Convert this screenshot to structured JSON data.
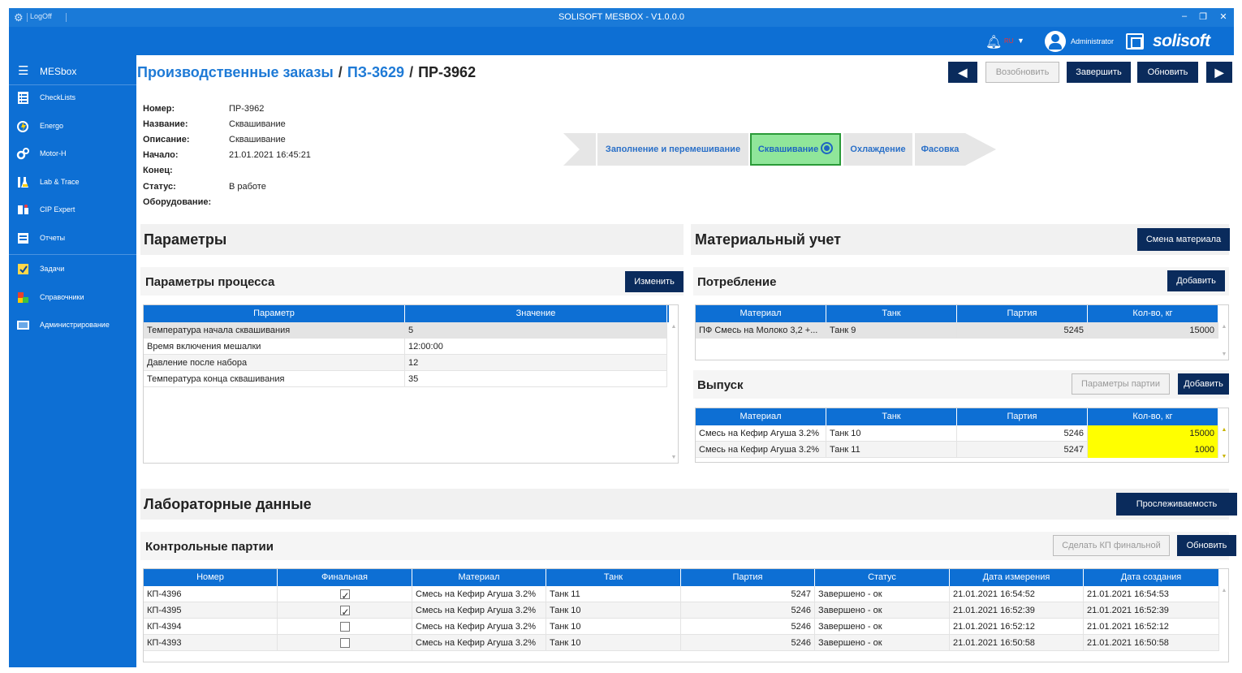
{
  "window": {
    "logoff": "LogOff",
    "title": "SOLISOFT MESBOX - V1.0.0.0",
    "minimize": "–",
    "restore": "❐",
    "close": "✕"
  },
  "topbar": {
    "lang": "RU",
    "user": "Administrator",
    "brand": "solisoft"
  },
  "sidebar": {
    "title": "MESbox",
    "items": [
      {
        "label": "CheckLists",
        "icon": "checklist-icon",
        "color": "#ffffff"
      },
      {
        "label": "Energo",
        "icon": "energy-icon",
        "color": "#ffcc00"
      },
      {
        "label": "Motor-H",
        "icon": "gears-icon",
        "color": "#ffffff"
      },
      {
        "label": "Lab & Trace",
        "icon": "lab-flask-icon",
        "color": "#ffffff"
      },
      {
        "label": "CIP Expert",
        "icon": "cip-icon",
        "color": "#ffffff"
      },
      {
        "label": "Отчеты",
        "icon": "report-icon",
        "color": "#ffffff"
      },
      {
        "label": "Задачи",
        "icon": "tasks-icon",
        "color": "#ffd84a"
      },
      {
        "label": "Справочники",
        "icon": "directory-icon",
        "color": "#e8402a"
      },
      {
        "label": "Администрирование",
        "icon": "admin-icon",
        "color": "#ffffff"
      }
    ]
  },
  "breadcrumb": {
    "root": "Производственные заказы",
    "sep": "/",
    "parent": "ПЗ-3629",
    "current": "ПР-3962"
  },
  "toolbar": {
    "back_icon": "◀",
    "resume": "Возобновить",
    "finish": "Завершить",
    "refresh": "Обновить",
    "forward_icon": "▶"
  },
  "info": {
    "number": {
      "label": "Номер:",
      "value": "ПР-3962"
    },
    "name": {
      "label": "Название:",
      "value": "Сквашивание"
    },
    "description": {
      "label": "Описание:",
      "value": "Сквашивание"
    },
    "start": {
      "label": "Начало:",
      "value": "21.01.2021 16:45:21"
    },
    "end": {
      "label": "Конец:",
      "value": ""
    },
    "status": {
      "label": "Статус:",
      "value": "В работе"
    },
    "equipment": {
      "label": "Оборудование:",
      "value": ""
    }
  },
  "stages": [
    {
      "label": "Заполнение и перемешивание",
      "active": false
    },
    {
      "label": "Сквашивание",
      "active": true
    },
    {
      "label": "Охлаждение",
      "active": false
    },
    {
      "label": "Фасовка",
      "active": false
    }
  ],
  "params": {
    "title": "Параметры",
    "sub_title": "Параметры процесса",
    "edit": "Изменить",
    "columns": [
      "Параметр",
      "Значение"
    ],
    "rows": [
      [
        "Температура начала сквашивания",
        "5"
      ],
      [
        "Время включения мешалки",
        "12:00:00"
      ],
      [
        "Давление после набора",
        "12"
      ],
      [
        "Температура конца сквашивания",
        "35"
      ]
    ]
  },
  "material": {
    "title": "Материальный учет",
    "change": "Смена материала",
    "consumption": {
      "title": "Потребление",
      "add": "Добавить",
      "columns": [
        "Материал",
        "Танк",
        "Партия",
        "Кол-во, кг"
      ],
      "rows": [
        [
          "ПФ Смесь на Молоко 3,2 +...",
          "Танк 9",
          "5245",
          "15000"
        ]
      ]
    },
    "output": {
      "title": "Выпуск",
      "batch_params": "Параметры партии",
      "add": "Добавить",
      "columns": [
        "Материал",
        "Танк",
        "Партия",
        "Кол-во, кг"
      ],
      "rows": [
        [
          "Смесь на Кефир Агуша 3.2%",
          "Танк 10",
          "5246",
          "15000"
        ],
        [
          "Смесь на Кефир Агуша 3.2%",
          "Танк 11",
          "5247",
          "1000"
        ]
      ]
    }
  },
  "lab": {
    "title": "Лабораторные данные",
    "trace": "Прослеживаемость",
    "sub_title": "Контрольные партии",
    "make_final": "Сделать КП финальной",
    "refresh": "Обновить",
    "columns": [
      "Номер",
      "Финальная",
      "Материал",
      "Танк",
      "Партия",
      "Статус",
      "Дата измерения",
      "Дата создания"
    ],
    "rows": [
      {
        "num": "КП-4396",
        "final": true,
        "material": "Смесь на Кефир Агуша 3.2%",
        "tank": "Танк 11",
        "batch": "5247",
        "status": "Завершено - ок",
        "measured": "21.01.2021 16:54:52",
        "created": "21.01.2021 16:54:53"
      },
      {
        "num": "КП-4395",
        "final": true,
        "material": "Смесь на Кефир Агуша 3.2%",
        "tank": "Танк 10",
        "batch": "5246",
        "status": "Завершено - ок",
        "measured": "21.01.2021 16:52:39",
        "created": "21.01.2021 16:52:39"
      },
      {
        "num": "КП-4394",
        "final": false,
        "material": "Смесь на Кефир Агуша 3.2%",
        "tank": "Танк 10",
        "batch": "5246",
        "status": "Завершено - ок",
        "measured": "21.01.2021 16:52:12",
        "created": "21.01.2021 16:52:12"
      },
      {
        "num": "КП-4393",
        "final": false,
        "material": "Смесь на Кефир Агуша 3.2%",
        "tank": "Танк 10",
        "batch": "5246",
        "status": "Завершено - ок",
        "measured": "21.01.2021 16:50:58",
        "created": "21.01.2021 16:50:58"
      }
    ]
  }
}
